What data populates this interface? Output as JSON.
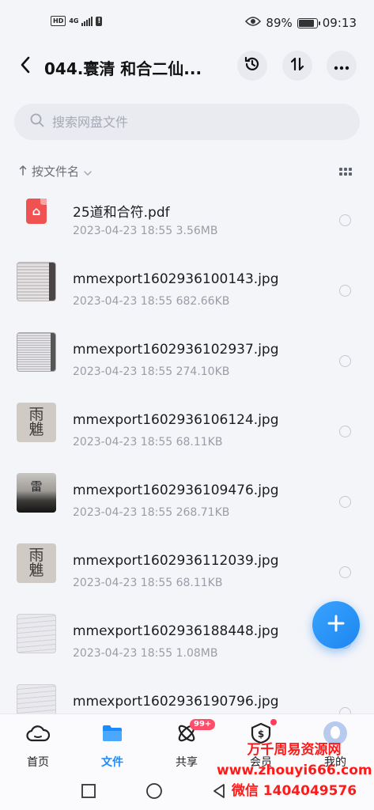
{
  "status_bar": {
    "hd_label": "HD",
    "network": "4G",
    "warning": "!",
    "battery_text": "89%",
    "battery_level": 0.89,
    "time": "09:13",
    "icons": [
      "eye-icon",
      "battery-icon",
      "signal-icon"
    ]
  },
  "header": {
    "title": "044.寰清 和合二仙...",
    "icons": [
      "back-arrow-icon",
      "history-icon",
      "sort-arrows-icon",
      "more-icon"
    ]
  },
  "search": {
    "placeholder": "搜索网盘文件",
    "value": ""
  },
  "sort": {
    "label": "按文件名",
    "icons": [
      "arrow-up-icon",
      "chevron-down-icon",
      "grid-view-icon"
    ]
  },
  "files": [
    {
      "name": "25道和合符.pdf",
      "meta": "2023-04-23  18:55  3.56MB",
      "thumb": "pdf"
    },
    {
      "name": "mmexport1602936100143.jpg",
      "meta": "2023-04-23  18:55  682.66KB",
      "thumb": "doc"
    },
    {
      "name": "mmexport1602936102937.jpg",
      "meta": "2023-04-23  18:55  274.10KB",
      "thumb": "doc2"
    },
    {
      "name": "mmexport1602936106124.jpg",
      "meta": "2023-04-23  18:55  68.11KB",
      "thumb": "paper"
    },
    {
      "name": "mmexport1602936109476.jpg",
      "meta": "2023-04-23  18:55  268.71KB",
      "thumb": "dark"
    },
    {
      "name": "mmexport1602936112039.jpg",
      "meta": "2023-04-23  18:55  68.11KB",
      "thumb": "paper"
    },
    {
      "name": "mmexport1602936188448.jpg",
      "meta": "2023-04-23  18:55  1.08MB",
      "thumb": "lined"
    },
    {
      "name": "mmexport1602936190796.jpg",
      "meta": "",
      "thumb": "lined"
    }
  ],
  "fab": {
    "icon": "plus-icon"
  },
  "tabs": [
    {
      "label": "首页",
      "icon": "cloud-icon",
      "active": false
    },
    {
      "label": "文件",
      "icon": "folder-icon",
      "active": true
    },
    {
      "label": "共享",
      "icon": "share-atom-icon",
      "active": false,
      "badge": "99+"
    },
    {
      "label": "会员",
      "icon": "vip-icon",
      "active": false
    },
    {
      "label": "我的",
      "icon": "avatar-icon",
      "active": false
    }
  ],
  "nav": {
    "icons": [
      "recents-square-icon",
      "home-circle-icon",
      "back-triangle-icon"
    ]
  },
  "colors": {
    "accent": "#1a8cff",
    "pdf_red": "#f05252",
    "badge": "#ff4d6a",
    "watermark": "#ff1a1a"
  },
  "watermark": {
    "line1": "万千周易资源网",
    "line2": "www.zhouyi666.com",
    "line3": "微信 1404049576"
  }
}
